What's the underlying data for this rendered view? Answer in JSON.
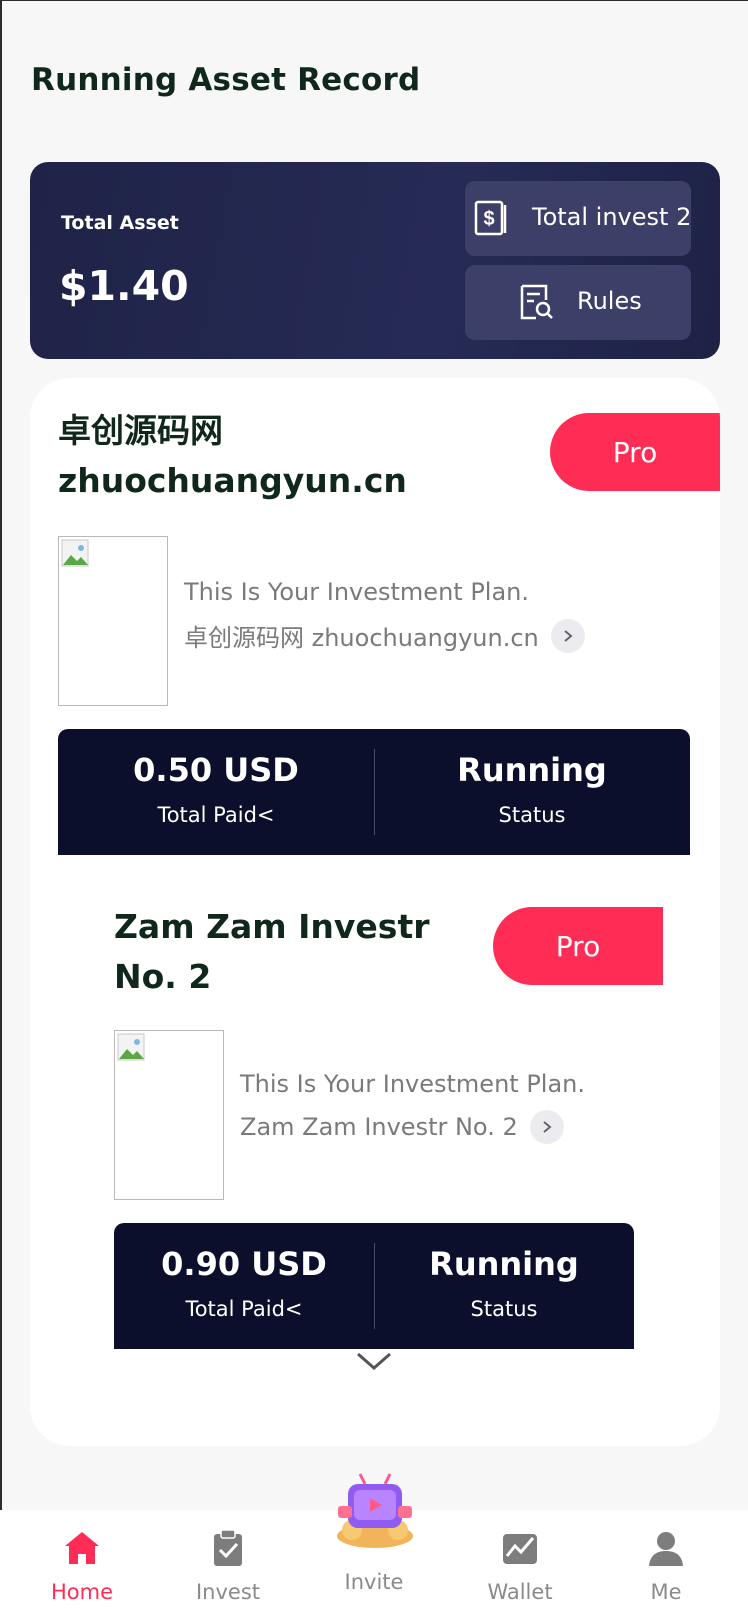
{
  "page": {
    "title": "Running Asset Record"
  },
  "summary": {
    "total_asset_label": "Total Asset",
    "total_asset_value": "$1.40",
    "total_invest_label": "Total invest 2",
    "rules_label": "Rules",
    "card_color": "#1f2347",
    "button_color": "#3c4068"
  },
  "plans": [
    {
      "name": "卓创源码网 zhuochuangyun.cn",
      "badge": "Pro",
      "description": "This Is Your Investment Plan.",
      "link_text": "卓创源码网 zhuochuangyun.cn",
      "total_paid_value": "0.50 USD",
      "total_paid_label": "Total Paid<",
      "status_value": "Running",
      "status_label": "Status"
    },
    {
      "name": "Zam Zam Investr No. 2",
      "badge": "Pro",
      "description": "This Is Your Investment Plan.",
      "link_text": "Zam Zam Investr No. 2",
      "total_paid_value": "0.90 USD",
      "total_paid_label": "Total Paid<",
      "status_value": "Running",
      "status_label": "Status"
    }
  ],
  "tabbar": {
    "items": [
      {
        "label": "Home",
        "icon": "home-icon",
        "active": true
      },
      {
        "label": "Invest",
        "icon": "clipboard-check-icon",
        "active": false
      },
      {
        "label": "Invite",
        "icon": "gift-tv-icon",
        "active": false
      },
      {
        "label": "Wallet",
        "icon": "chart-line-icon",
        "active": false
      },
      {
        "label": "Me",
        "icon": "user-icon",
        "active": false
      }
    ]
  },
  "colors": {
    "accent": "#ff2d55",
    "stats_bg": "#0c0f2b",
    "title_text": "#10281c"
  }
}
